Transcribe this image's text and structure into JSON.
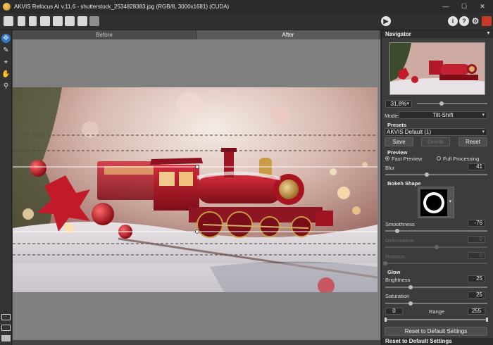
{
  "window": {
    "title": "AKVIS Refocus AI v.11.6 - shutterstock_2534828383.jpg (RGB/8, 3000x1681) (CUDA)",
    "controls": [
      "minimize-icon",
      "maximize-icon",
      "close-icon"
    ]
  },
  "toolbar": {
    "left_icons": [
      "home-icon",
      "open-file-icon",
      "save-file-icon",
      "print-icon",
      "share-icon",
      "batch-icon",
      "undo-icon",
      "redo-icon"
    ],
    "right_icons": [
      "run-icon",
      "info-icon",
      "help-icon",
      "settings-icon",
      "akvis-book-icon"
    ]
  },
  "tools": [
    "refocus-tool-icon",
    "brush-tool-icon",
    "crop-tool-icon",
    "hand-tool-icon",
    "zoom-tool-icon"
  ],
  "view_modes": [
    "single-view-icon",
    "split-view-icon",
    "compare-view-icon"
  ],
  "tabs": {
    "before": "Before",
    "after": "After"
  },
  "panel": {
    "navigator_title": "Navigator",
    "zoom": "31.8%",
    "mode_label": "Mode:",
    "mode_value": "Tilt-Shift",
    "presets_title": "Presets",
    "preset_value": "AKVIS Default (1)",
    "save_label": "Save",
    "delete_label": "Delete",
    "reset_label": "Reset",
    "preview_title": "Preview",
    "fast_preview": "Fast Preview",
    "full_processing": "Full Processing",
    "blur_label": "Blur",
    "blur_value": "41",
    "blur_level": 0.41,
    "bokeh_title": "Bokeh Shape",
    "smoothness_label": "Smoothness",
    "smoothness_value": "-76",
    "smoothness_level": 0.12,
    "deformation_label": "Deformation",
    "deformation_value": "0",
    "deformation_level": 0.5,
    "rotation_label": "Rotation",
    "rotation_value": "0",
    "rotation_level": 0.0,
    "glow_title": "Glow",
    "brightness_label": "Brightness",
    "brightness_value": "25",
    "brightness_level": 0.25,
    "saturation_label": "Saturation",
    "saturation_value": "25",
    "saturation_level": 0.25,
    "range_label": "Range",
    "range_min": "0",
    "range_max": "255",
    "reset_defaults_label": "Reset to Default Settings",
    "reset_defaults_footer": "Reset to Default Settings"
  },
  "colors": {
    "accent": "#2d78c8",
    "train_red": "#b01a2a",
    "brass": "#c79a45"
  }
}
